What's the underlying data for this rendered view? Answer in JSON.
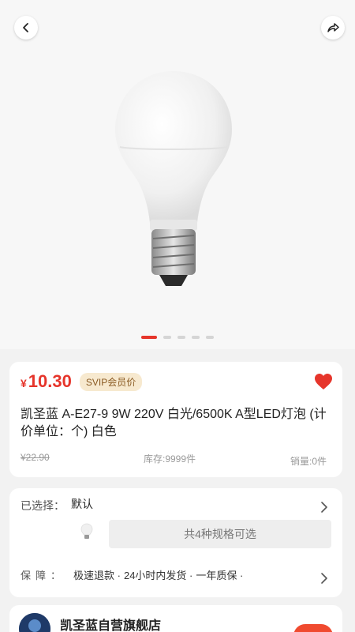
{
  "carousel": {
    "count": 5,
    "active_index": 0
  },
  "product": {
    "currency_symbol": "¥",
    "price": "10.30",
    "svip_label": "SVIP会员价",
    "title": "凯圣蓝 A-E27-9 9W 220V 白光/6500K A型LED灯泡 (计价单位：个) 白色",
    "original_price": "¥22.90",
    "stock_text": "库存:9999件",
    "sales_text": "销量:0件",
    "favorited": true
  },
  "spec": {
    "selected_label": "已选择：",
    "selected_value": "默认",
    "spec_button_label": "共4种规格可选"
  },
  "guarantee": {
    "label": "保障：",
    "items": [
      "极速退款 ·",
      "24小时内发货 ·",
      "一年质保 ·"
    ]
  },
  "shop": {
    "name": "凯圣蓝自营旗舰店"
  },
  "colors": {
    "accent": "#e6352b",
    "svip_bg": "#f7e9cf",
    "svip_text": "#8a5a22"
  }
}
